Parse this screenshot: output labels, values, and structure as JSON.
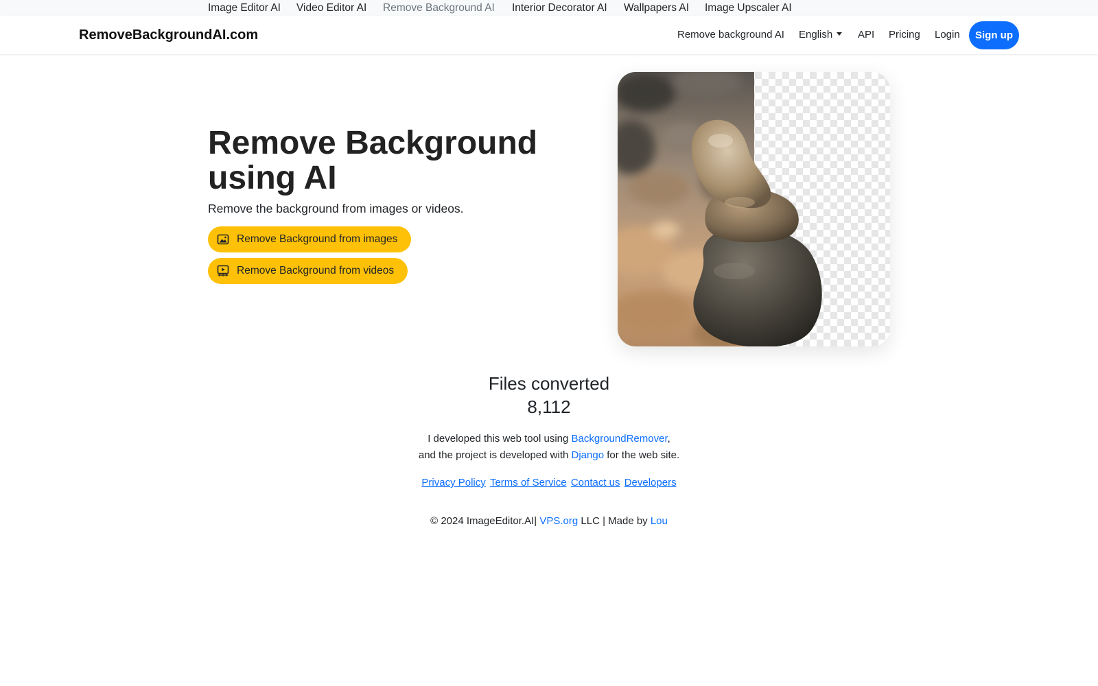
{
  "topbar": {
    "links": [
      {
        "label": "Image Editor AI"
      },
      {
        "label": "Video Editor AI"
      },
      {
        "label": "Remove Background AI"
      },
      {
        "label": "Interior Decorator AI"
      },
      {
        "label": "Wallpapers AI"
      },
      {
        "label": "Image Upscaler AI"
      }
    ]
  },
  "navbar": {
    "brand": "RemoveBackgroundAI.com",
    "remove_bg": "Remove background AI",
    "language": "English",
    "api": "API",
    "pricing": "Pricing",
    "login": "Login",
    "signup": "Sign up"
  },
  "hero": {
    "title": "Remove Background using AI",
    "subtitle": "Remove the background from images or videos.",
    "cta_images": "Remove Background from images",
    "cta_images_icon": "image-icon",
    "cta_videos": "Remove Background from videos",
    "cta_videos_icon": "video-icon"
  },
  "stats": {
    "label": "Files converted",
    "value": "8,112"
  },
  "credits": {
    "line1_prefix": "I developed this web tool using ",
    "line1_link": "BackgroundRemover",
    "line1_suffix": ",",
    "line2_prefix": "and the project is developed with ",
    "line2_link": "Django",
    "line2_suffix": " for the web site."
  },
  "footer": {
    "links": [
      {
        "label": "Privacy Policy"
      },
      {
        "label": "Terms of Service"
      },
      {
        "label": "Contact us"
      },
      {
        "label": "Developers"
      }
    ],
    "copyright_prefix": "© 2024 ImageEditor.AI| ",
    "copyright_link": "VPS.org",
    "copyright_mid": " LLC | Made by ",
    "copyright_author": "Lou"
  },
  "colors": {
    "primary": "#0d6efd",
    "cta": "#ffc107",
    "topbar_bg": "#f8f9fa"
  }
}
